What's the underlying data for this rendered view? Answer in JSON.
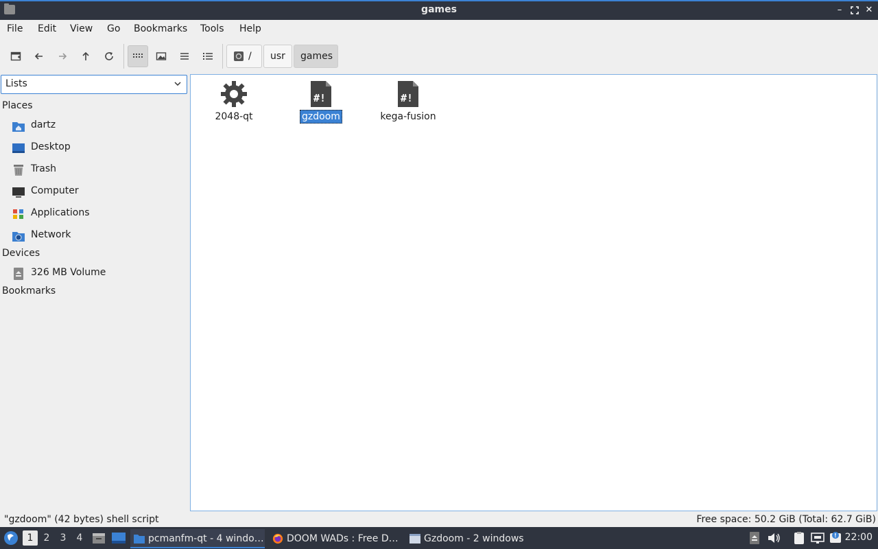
{
  "window": {
    "title": "games"
  },
  "menubar": {
    "items": [
      "File",
      "Edit",
      "View",
      "Go",
      "Bookmarks",
      "Tools",
      "Help"
    ]
  },
  "breadcrumb": {
    "root": "/",
    "parts": [
      "usr",
      "games"
    ]
  },
  "sidebar": {
    "combo_value": "Lists",
    "places_heading": "Places",
    "places": [
      "dartz",
      "Desktop",
      "Trash",
      "Computer",
      "Applications",
      "Network"
    ],
    "devices_heading": "Devices",
    "devices": [
      "326 MB Volume"
    ],
    "bookmarks_heading": "Bookmarks"
  },
  "files": [
    {
      "name": "2048-qt",
      "icon": "gear-icon",
      "selected": false
    },
    {
      "name": "gzdoom",
      "icon": "script-file-icon",
      "selected": true
    },
    {
      "name": "kega-fusion",
      "icon": "script-file-icon",
      "selected": false
    }
  ],
  "statusbar": {
    "left": "\"gzdoom\" (42 bytes) shell script",
    "right": "Free space: 50.2 GiB (Total: 62.7 GiB)"
  },
  "taskbar": {
    "workspaces": [
      "1",
      "2",
      "3",
      "4"
    ],
    "active_workspace": "1",
    "tasks": [
      "pcmanfm-qt - 4 windo…",
      "DOOM WADs : Free D…",
      "Gzdoom - 2 windows"
    ],
    "clock": "22:00"
  },
  "colors": {
    "accent": "#3b82d4",
    "titlebar": "#2f343f",
    "panel": "#efefef"
  }
}
